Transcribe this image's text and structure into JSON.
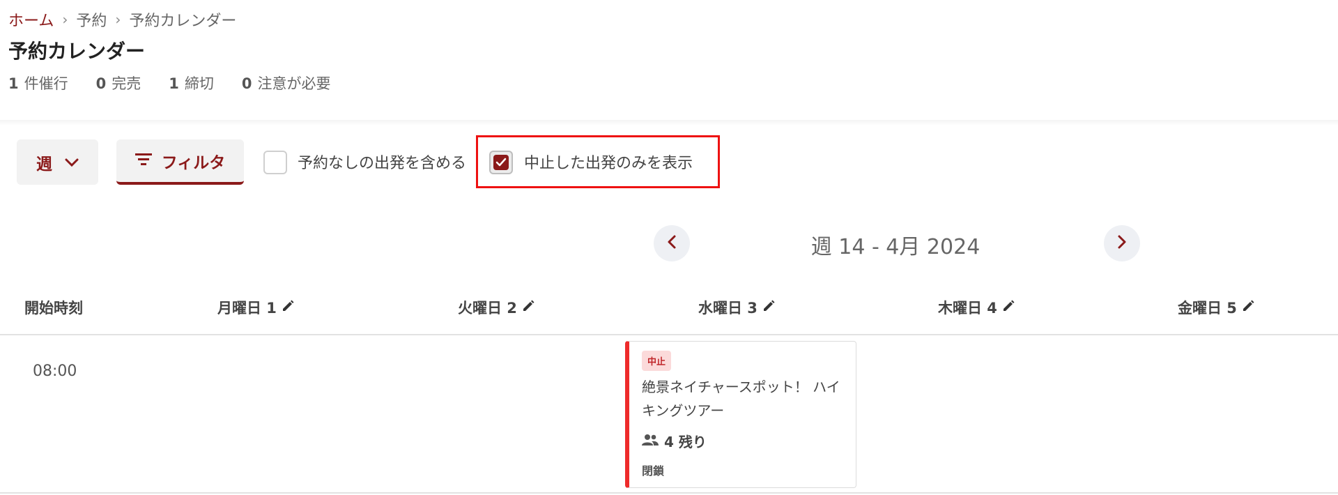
{
  "breadcrumb": {
    "home": "ホーム",
    "level2": "予約",
    "level3": "予約カレンダー"
  },
  "page_title": "予約カレンダー",
  "stats": [
    {
      "count": "1",
      "label": "件催行"
    },
    {
      "count": "0",
      "label": "完売"
    },
    {
      "count": "1",
      "label": "締切"
    },
    {
      "count": "0",
      "label": "注意が必要"
    }
  ],
  "toolbar": {
    "view_select": "週",
    "filter_label": "フィルタ",
    "include_unbooked": {
      "label": "予約なしの出発を含める",
      "checked": false
    },
    "cancelled_only": {
      "label": "中止した出発のみを表示",
      "checked": true
    }
  },
  "week_nav": {
    "label": "週 14 - 4月 2024"
  },
  "calendar": {
    "columns": [
      "開始時刻",
      "月曜日 1",
      "火曜日 2",
      "水曜日 3",
      "木曜日 4",
      "金曜日 5"
    ],
    "rows": [
      {
        "time": "08:00",
        "event": {
          "badge": "中止",
          "title": "絶景ネイチャースポット！ ハイキングツアー",
          "seats": "4 残り",
          "status": "閉鎖"
        }
      }
    ]
  },
  "colors": {
    "accent": "#8b1a1a",
    "cancelled": "#ee2b2b",
    "highlight": "#ee1111"
  }
}
